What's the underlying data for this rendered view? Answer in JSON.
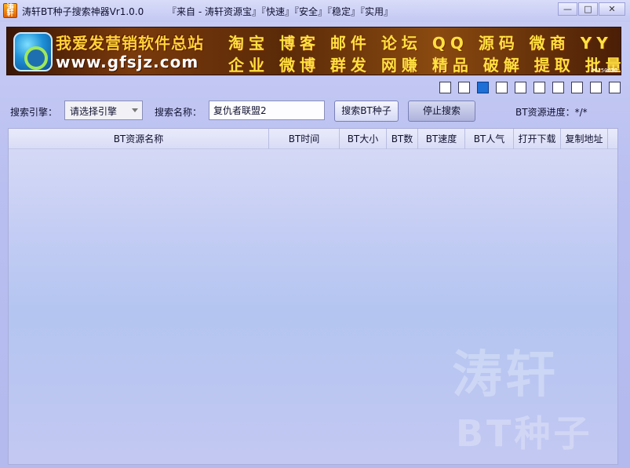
{
  "window": {
    "title": "涛轩BT种子搜索神器Vr1.0.0",
    "slogan": "『来自 - 涛轩资源宝』『快速』『安全』『稳定』『实用』",
    "app_icon_text": "涛轩",
    "controls": {
      "minimize": "—",
      "maximize": "□",
      "close": "✕"
    }
  },
  "banner": {
    "line1": "我爱发营销软件总站",
    "line2": "www.gfsjz.com",
    "words_row1": "淘宝 博客 邮件 论坛 QQ 源码 微商 YY 旺旺",
    "words_row2": "企业 微博 群发 网赚 精品 破解 提取 批量 营销",
    "date": "20150630",
    "logo_icon": "globe-logo-icon"
  },
  "pages": {
    "count": 10,
    "active_index": 2
  },
  "search": {
    "engine_label": "搜索引擎：",
    "engine_value": "请选择引擎",
    "name_label": "搜索名称：",
    "name_value": "复仇者联盟2",
    "search_button": "搜索BT种子",
    "stop_button": "停止搜索",
    "progress": "BT资源进度：*/*"
  },
  "table": {
    "columns": [
      "BT资源名称",
      "BT时间",
      "BT大小",
      "BT数",
      "BT速度",
      "BT人气",
      "打开下载",
      "复制地址"
    ],
    "rows": []
  },
  "watermark": {
    "line1": "涛轩",
    "line2": "BT种子"
  },
  "colors": {
    "accent": "#1e6fd6",
    "background": "#b9bff0",
    "banner_yellow": "#ffe040"
  }
}
